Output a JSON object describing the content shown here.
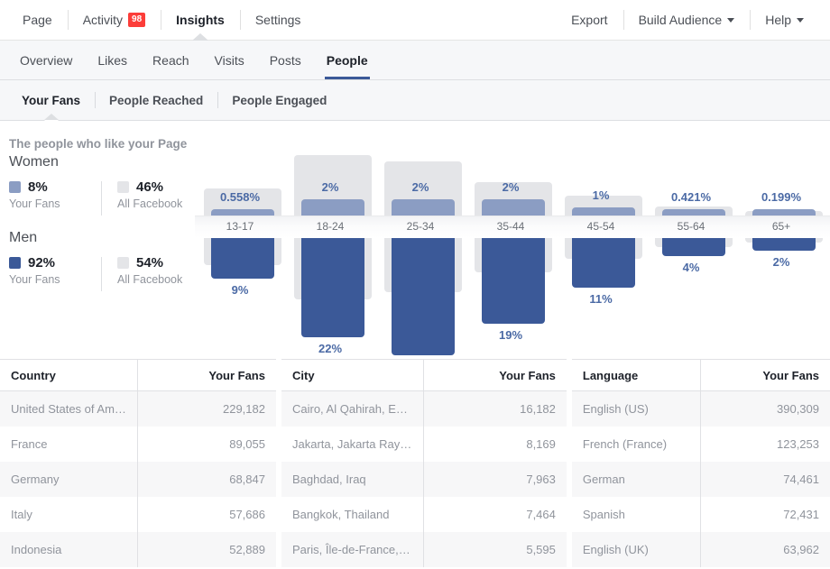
{
  "topnav": {
    "left_items": [
      {
        "label": "Page",
        "active": false,
        "badge": null,
        "caret": false
      },
      {
        "label": "Activity",
        "active": false,
        "badge": "98",
        "caret": false
      },
      {
        "label": "Insights",
        "active": true,
        "badge": null,
        "caret": false
      },
      {
        "label": "Settings",
        "active": false,
        "badge": null,
        "caret": false
      }
    ],
    "right_items": [
      {
        "label": "Export",
        "dropdown": false
      },
      {
        "label": "Build Audience",
        "dropdown": true
      },
      {
        "label": "Help",
        "dropdown": true
      }
    ]
  },
  "secnav": {
    "items": [
      {
        "label": "Overview",
        "active": false
      },
      {
        "label": "Likes",
        "active": false
      },
      {
        "label": "Reach",
        "active": false
      },
      {
        "label": "Visits",
        "active": false
      },
      {
        "label": "Posts",
        "active": false
      },
      {
        "label": "People",
        "active": true
      }
    ]
  },
  "subtabs": {
    "items": [
      {
        "label": "Your Fans",
        "active": true
      },
      {
        "label": "People Reached",
        "active": false
      },
      {
        "label": "People Engaged",
        "active": false
      }
    ]
  },
  "page_subtitle": "The people who like your Page",
  "legend": {
    "women": {
      "title": "Women",
      "your_fans_value": "8%",
      "your_fans_label": "Your Fans",
      "all_facebook_value": "46%",
      "all_facebook_label": "All Facebook",
      "swatch_color": "#8b9dc3",
      "all_swatch_color": "#e4e5e8"
    },
    "men": {
      "title": "Men",
      "your_fans_value": "92%",
      "your_fans_label": "Your Fans",
      "all_facebook_value": "54%",
      "all_facebook_label": "All Facebook",
      "swatch_color": "#3b5998",
      "all_swatch_color": "#e4e5e8"
    }
  },
  "chart_data": {
    "type": "bar",
    "title": "Age and gender distribution of your fans",
    "xlabel": "Age range",
    "ylabel": "Percent of fans",
    "categories": [
      "13-17",
      "18-24",
      "25-34",
      "35-44",
      "45-54",
      "55-64",
      "65+"
    ],
    "series": [
      {
        "name": "Women (Your Fans)",
        "color": "#8b9dc3",
        "direction": "up",
        "labels": [
          "0.558%",
          "2%",
          "2%",
          "2%",
          "1%",
          "0.421%",
          "0.199%"
        ],
        "values": [
          0.558,
          2,
          2,
          2,
          1,
          0.421,
          0.199
        ]
      },
      {
        "name": "Men (Your Fans)",
        "color": "#3b5998",
        "direction": "down",
        "labels": [
          "9%",
          "22%",
          "26%",
          "19%",
          "11%",
          "4%",
          "2%"
        ],
        "values": [
          9,
          22,
          26,
          19,
          11,
          4,
          2
        ]
      },
      {
        "name": "All Facebook",
        "color": "#e4e5e8",
        "direction": "background",
        "labels": [],
        "values": [
          13,
          28,
          25,
          16,
          10,
          5,
          3
        ]
      }
    ],
    "legend_position": "left",
    "grid": false
  },
  "tables": [
    {
      "id": "country",
      "columns": [
        "Country",
        "Your Fans"
      ],
      "rows": [
        [
          "United States of America",
          "229,182"
        ],
        [
          "France",
          "89,055"
        ],
        [
          "Germany",
          "68,847"
        ],
        [
          "Italy",
          "57,686"
        ],
        [
          "Indonesia",
          "52,889"
        ]
      ]
    },
    {
      "id": "city",
      "columns": [
        "City",
        "Your Fans"
      ],
      "rows": [
        [
          "Cairo, Al Qahirah, Egypt",
          "16,182"
        ],
        [
          "Jakarta, Jakarta Raya, Ind...",
          "8,169"
        ],
        [
          "Baghdad, Iraq",
          "7,963"
        ],
        [
          "Bangkok, Thailand",
          "7,464"
        ],
        [
          "Paris, Île-de-France, France",
          "5,595"
        ]
      ]
    },
    {
      "id": "language",
      "columns": [
        "Language",
        "Your Fans"
      ],
      "rows": [
        [
          "English (US)",
          "390,309"
        ],
        [
          "French (France)",
          "123,253"
        ],
        [
          "German",
          "74,461"
        ],
        [
          "Spanish",
          "72,431"
        ],
        [
          "English (UK)",
          "63,962"
        ]
      ]
    }
  ]
}
